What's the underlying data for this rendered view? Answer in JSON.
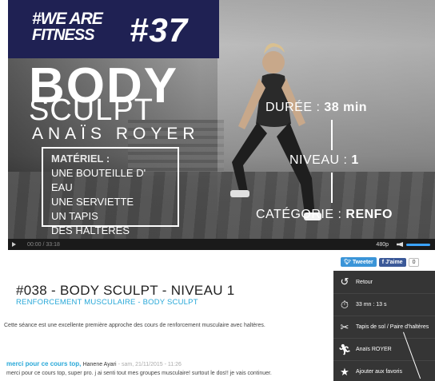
{
  "video": {
    "logo_line1": "#WE ARE",
    "logo_line2": "FITNESS",
    "episode_number": "#37",
    "title_line1": "BODY",
    "title_line2": "SCULPT",
    "coach": "ANAÏS ROYER",
    "materiel_heading": "MATÉRIEL :",
    "materiel_items": [
      "UNE BOUTEILLE D' EAU",
      "UNE SERVIETTE",
      "UN TAPIS",
      "DES HALTERES"
    ],
    "duree_label": "DURÉE : ",
    "duree_value": "38 min",
    "niveau_label": "NIVEAU : ",
    "niveau_value": "1",
    "categorie_label": "CATÉGORIE : ",
    "categorie_value": "RENFO",
    "time_display": "00:00 / 33:18",
    "quality": "480p",
    "play_icon": "play-icon",
    "volume_icon": "volume-icon"
  },
  "social": {
    "tweet_label": "Tweeter",
    "fb_label": "J'aime",
    "fb_count": "0"
  },
  "content": {
    "title": "#038 - BODY SCULPT - NIVEAU 1",
    "subtitle_cat": "RENFORCEMENT MUSCULAIRE",
    "subtitle_sep": " - ",
    "subtitle_tag": "BODY SCULPT",
    "description": "Cette séance est une excellente première approche des cours de renforcement musculaire avec haltères."
  },
  "comment": {
    "title": "merci pour ce cours top,",
    "author": "Hanene Ayari",
    "date": "- sam, 21/11/2015 - 11:26",
    "body": "merci pour ce cours top, super pro. j ai senti tout mes groupes musculaire! surtout le dos!! je vais continuer."
  },
  "sidebar": {
    "items": [
      {
        "icon": "back-icon",
        "label": "Retour"
      },
      {
        "icon": "stopwatch-icon",
        "label": "33 mn : 13 s"
      },
      {
        "icon": "equipment-icon",
        "label": "Tapis de sol / Paire d'haltères"
      },
      {
        "icon": "coach-icon",
        "label": "Anaïs ROYER"
      },
      {
        "icon": "star-icon",
        "label": "Ajouter aux favoris"
      }
    ]
  },
  "colors": {
    "accent": "#28a8d8",
    "logo_band": "#1f2153",
    "sidebar_bg": "#353535",
    "twitter": "#3b95d8",
    "facebook": "#3b5998"
  }
}
